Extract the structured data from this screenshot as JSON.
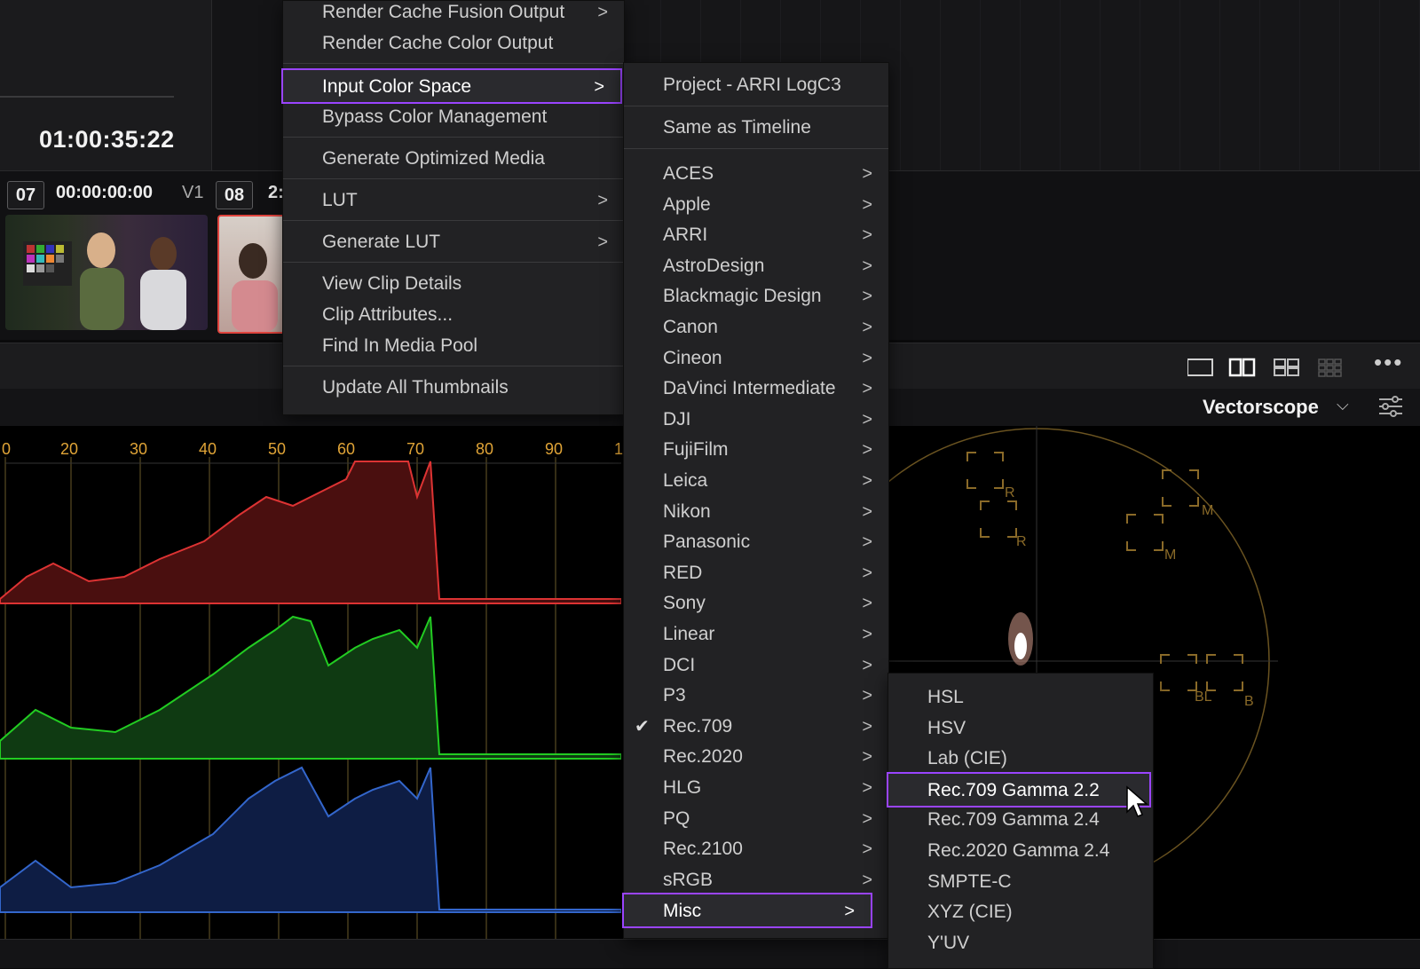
{
  "viewer": {
    "timecode": "01:00:35:22"
  },
  "clips": [
    {
      "number": "07",
      "timecode": "00:00:00:00",
      "track": "V1"
    },
    {
      "number": "08",
      "timecode_partial": "2:"
    }
  ],
  "scope": {
    "type_label": "Vectorscope",
    "ruler_ticks": [
      "0",
      "20",
      "30",
      "40",
      "50",
      "60",
      "70",
      "80",
      "90",
      "1"
    ],
    "vector_labels": [
      "R",
      "R",
      "M",
      "M",
      "BL",
      "B"
    ]
  },
  "context_menu": {
    "items": [
      {
        "label": "Render Cache Fusion Output",
        "submenu": true
      },
      {
        "label": "Render Cache Color Output",
        "submenu": false
      },
      {
        "label": "Input Color Space",
        "submenu": true,
        "highlighted": true
      },
      {
        "label": "Bypass Color Management",
        "submenu": false
      },
      {
        "label": "Generate Optimized Media",
        "submenu": false
      },
      {
        "label": "LUT",
        "submenu": true
      },
      {
        "label": "Generate LUT",
        "submenu": true
      },
      {
        "label": "View Clip Details",
        "submenu": false
      },
      {
        "label": "Clip Attributes...",
        "submenu": false
      },
      {
        "label": "Find In Media Pool",
        "submenu": false
      },
      {
        "label": "Update All Thumbnails",
        "submenu": false
      }
    ]
  },
  "color_space_menu": {
    "items": [
      {
        "label": "Project - ARRI LogC3"
      },
      {
        "label": "Same as Timeline"
      },
      {
        "label": "ACES"
      },
      {
        "label": "Apple"
      },
      {
        "label": "ARRI"
      },
      {
        "label": "AstroDesign"
      },
      {
        "label": "Blackmagic Design"
      },
      {
        "label": "Canon"
      },
      {
        "label": "Cineon"
      },
      {
        "label": "DaVinci Intermediate"
      },
      {
        "label": "DJI"
      },
      {
        "label": "FujiFilm"
      },
      {
        "label": "Leica"
      },
      {
        "label": "Nikon"
      },
      {
        "label": "Panasonic"
      },
      {
        "label": "RED"
      },
      {
        "label": "Sony"
      },
      {
        "label": "Linear"
      },
      {
        "label": "DCI"
      },
      {
        "label": "P3"
      },
      {
        "label": "Rec.709",
        "checked": true
      },
      {
        "label": "Rec.2020"
      },
      {
        "label": "HLG"
      },
      {
        "label": "PQ"
      },
      {
        "label": "Rec.2100"
      },
      {
        "label": "sRGB"
      },
      {
        "label": "Misc",
        "highlighted": true
      }
    ]
  },
  "misc_menu": {
    "items": [
      {
        "label": "HSL"
      },
      {
        "label": "HSV"
      },
      {
        "label": "Lab (CIE)"
      },
      {
        "label": "Rec.709 Gamma 2.2",
        "highlighted": true
      },
      {
        "label": "Rec.709 Gamma 2.4"
      },
      {
        "label": "Rec.2020 Gamma 2.4"
      },
      {
        "label": "SMPTE-C"
      },
      {
        "label": "XYZ (CIE)"
      },
      {
        "label": "Y'UV"
      }
    ]
  },
  "colors": {
    "highlight_border": "#9a44ff",
    "menu_bg": "#222224",
    "accent_orange": "#e0a437"
  }
}
